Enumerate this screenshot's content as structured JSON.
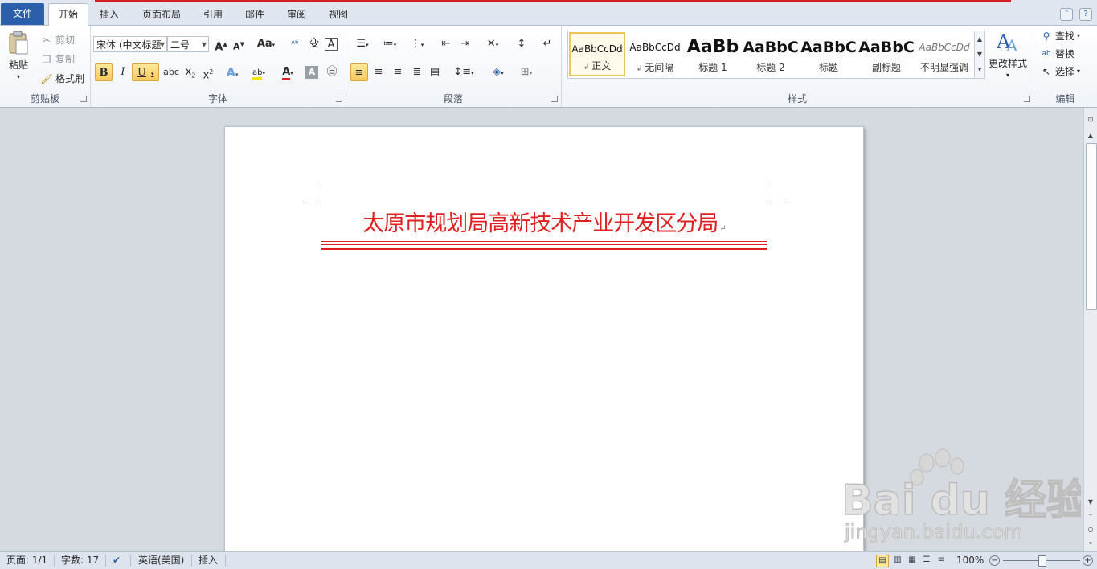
{
  "tabs": [
    {
      "label": "文件",
      "key": "file"
    },
    {
      "label": "开始",
      "key": "home"
    },
    {
      "label": "插入",
      "key": "insert"
    },
    {
      "label": "页面布局",
      "key": "layout"
    },
    {
      "label": "引用",
      "key": "references"
    },
    {
      "label": "邮件",
      "key": "mailings"
    },
    {
      "label": "审阅",
      "key": "review"
    },
    {
      "label": "视图",
      "key": "view"
    }
  ],
  "ribbon": {
    "clipboard": {
      "group_label": "剪贴板",
      "paste": "粘贴",
      "cut": "剪切",
      "copy": "复制",
      "format_painter": "格式刷"
    },
    "font": {
      "group_label": "字体",
      "font_name": "宋体 (中文标题",
      "font_size": "二号",
      "grow": "A",
      "shrink": "A",
      "change_case": "Aa",
      "bold": "B",
      "italic": "I",
      "underline": "U",
      "strike": "abc",
      "subscript": "x",
      "superscript": "x"
    },
    "paragraph": {
      "group_label": "段落"
    },
    "styles": {
      "group_label": "样式",
      "items": [
        {
          "sample": "AaBbCcDd",
          "name": "正文"
        },
        {
          "sample": "AaBbCcDd",
          "name": "无间隔"
        },
        {
          "sample": "AaBb",
          "name": "标题 1"
        },
        {
          "sample": "AaBbC",
          "name": "标题 2"
        },
        {
          "sample": "AaBbC",
          "name": "标题"
        },
        {
          "sample": "AaBbC",
          "name": "副标题"
        },
        {
          "sample": "AaBbCcDd",
          "name": "不明显强调"
        }
      ],
      "change_styles": "更改样式"
    },
    "editing": {
      "group_label": "编辑",
      "find": "查找",
      "replace": "替换",
      "select": "选择"
    }
  },
  "document": {
    "heading": "太原市规划局高新技术产业开发区分局",
    "heading_color": "#e02020"
  },
  "status": {
    "page": "页面: 1/1",
    "words": "字数: 17",
    "language": "英语(美国)",
    "mode": "插入",
    "zoom": "100%",
    "zoom_level": 1.0
  },
  "watermark": {
    "logo": "Bai du 经验",
    "url": "jingyan.baidu.com"
  },
  "colors": {
    "accent": "#2c5faa",
    "heading_red": "#e02020",
    "selected_style": "#f0c75c"
  }
}
